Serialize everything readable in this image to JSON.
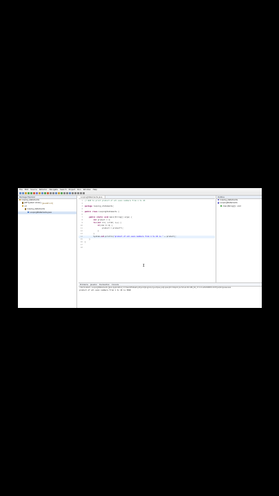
{
  "menu": [
    "File",
    "Edit",
    "Source",
    "Refactor",
    "Navigate",
    "Search",
    "Project",
    "Run",
    "Window",
    "Help"
  ],
  "package_explorer": {
    "title": "Package Explorer",
    "items": [
      {
        "label": "looping_statements",
        "indent": 0,
        "icon": "project-icon"
      },
      {
        "label": "JRE System Library",
        "suffix": "[JavaSE-1.8]",
        "indent": 1,
        "icon": "library-icon"
      },
      {
        "label": "src",
        "indent": 1,
        "icon": "folder-icon"
      },
      {
        "label": "looping_statements",
        "indent": 2,
        "icon": "package-icon"
      },
      {
        "label": "LoopingStatements.java",
        "indent": 3,
        "icon": "java-file-icon",
        "selected": true
      }
    ]
  },
  "editor": {
    "tab": "LoopingStatements.java",
    "lines": [
      {
        "no": "1",
        "html": "<span class='cm'>// WAP to print product of all even numbers from 1 to 10</span>"
      },
      {
        "no": "2",
        "html": ""
      },
      {
        "no": "3",
        "html": "<span class='kw'>package</span> looping_statements;"
      },
      {
        "no": "4",
        "html": ""
      },
      {
        "no": "5",
        "html": "<span class='kw'>public class</span> LoopingStatements {"
      },
      {
        "no": "6",
        "html": ""
      },
      {
        "no": "7",
        "html": "    <span class='kw'>public static void</span> main(String[] args) {"
      },
      {
        "no": "8",
        "html": "        <span class='kw'>int</span> product = 1;"
      },
      {
        "no": "9",
        "html": "        <span class='kw'>for</span>(<span class='kw'>int</span> i=1; i&lt;=10; i++) {"
      },
      {
        "no": "10",
        "html": "            <span class='kw'>if</span>(i%2 == 0) {"
      },
      {
        "no": "11",
        "html": "                product = product*i;"
      },
      {
        "no": "12",
        "html": "            }"
      },
      {
        "no": "13",
        "html": "        }"
      },
      {
        "no": "14",
        "html": "        System.<span class='kw'>out</span>.println(<span class='st'>\"product of all even numbers from 1 to 10 is \"</span> + product);",
        "highlight": true
      },
      {
        "no": "15",
        "html": "    }"
      },
      {
        "no": "16",
        "html": "}"
      },
      {
        "no": "17",
        "html": ""
      },
      {
        "no": "18",
        "html": ""
      }
    ]
  },
  "outline": {
    "title": "Outline",
    "items": [
      {
        "label": "looping_statements",
        "indent": 0
      },
      {
        "label": "LoopingStatements",
        "indent": 0
      },
      {
        "label": "main(String[]) : void",
        "indent": 1
      }
    ]
  },
  "bottom": {
    "tabs": [
      "Problems",
      "Javadoc",
      "Declaration",
      "Console"
    ],
    "terminated": "<terminated> LoopingStatements [Java Application] C:\\Users\\Prateek\\.p2\\pool\\plugins\\org.eclipse.justj.openjdk.hotspot.jre.full.win32.x86_64_17.0.4.v20220805-1047\\jre\\bin\\javaw.exe",
    "output": "product of all even numbers from 1 to 10 is 3840"
  }
}
